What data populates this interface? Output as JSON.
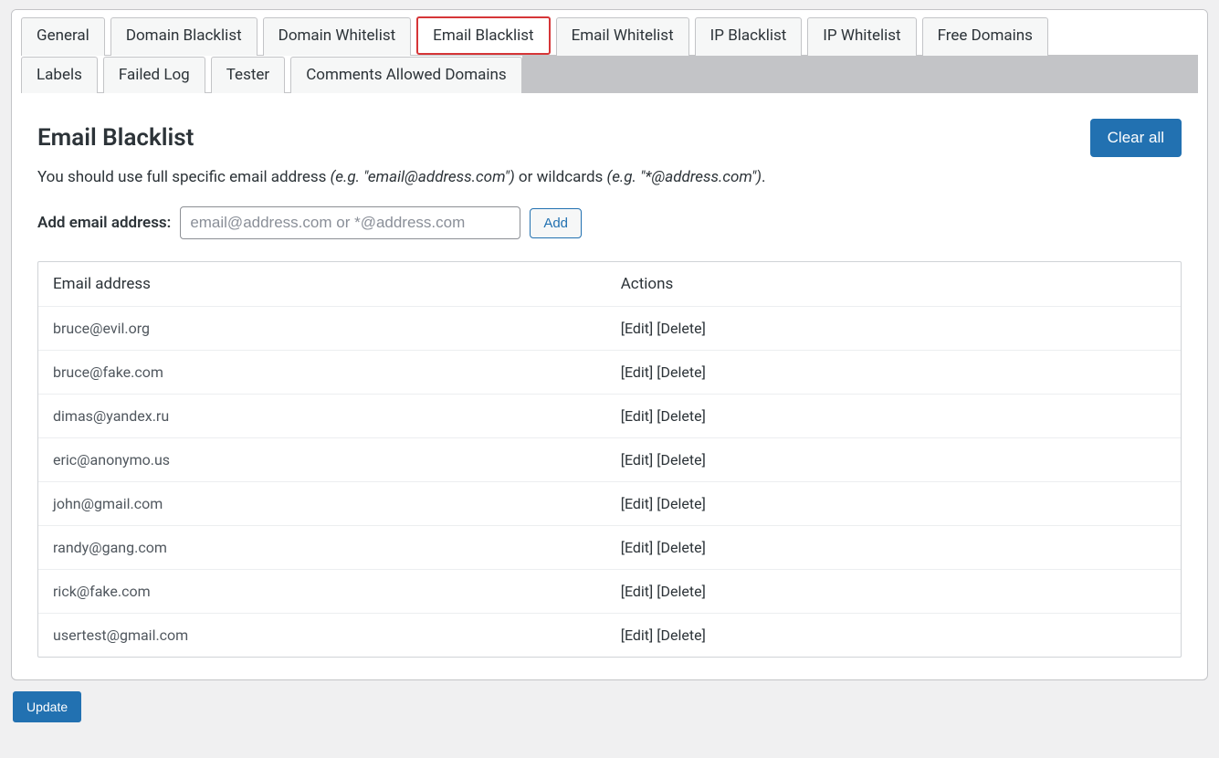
{
  "tabs_row1": [
    {
      "label": "General",
      "id": "general"
    },
    {
      "label": "Domain Blacklist",
      "id": "domain-blacklist"
    },
    {
      "label": "Domain Whitelist",
      "id": "domain-whitelist"
    },
    {
      "label": "Email Blacklist",
      "id": "email-blacklist",
      "active": true
    },
    {
      "label": "Email Whitelist",
      "id": "email-whitelist"
    },
    {
      "label": "IP Blacklist",
      "id": "ip-blacklist"
    },
    {
      "label": "IP Whitelist",
      "id": "ip-whitelist"
    },
    {
      "label": "Free Domains",
      "id": "free-domains"
    }
  ],
  "tabs_row2": [
    {
      "label": "Labels",
      "id": "labels"
    },
    {
      "label": "Failed Log",
      "id": "failed-log"
    },
    {
      "label": "Tester",
      "id": "tester"
    },
    {
      "label": "Comments Allowed Domains",
      "id": "comments-allowed-domains"
    }
  ],
  "heading": "Email Blacklist",
  "clear_all_label": "Clear all",
  "intro_prefix": "You should use full specific email address ",
  "intro_eg1": "(e.g. \"email@address.com\")",
  "intro_mid": " or wildcards ",
  "intro_eg2": "(e.g. \"*@address.com\")",
  "intro_suffix": ".",
  "add_label": "Add email address:",
  "add_placeholder": "email@address.com or *@address.com",
  "add_button": "Add",
  "columns": {
    "email": "Email address",
    "actions": "Actions"
  },
  "row_action_edit": "[Edit]",
  "row_action_delete": "[Delete]",
  "rows": [
    {
      "email": "bruce@evil.org"
    },
    {
      "email": "bruce@fake.com"
    },
    {
      "email": "dimas@yandex.ru"
    },
    {
      "email": "eric@anonymo.us"
    },
    {
      "email": "john@gmail.com"
    },
    {
      "email": "randy@gang.com"
    },
    {
      "email": "rick@fake.com"
    },
    {
      "email": "usertest@gmail.com"
    }
  ],
  "update_label": "Update"
}
